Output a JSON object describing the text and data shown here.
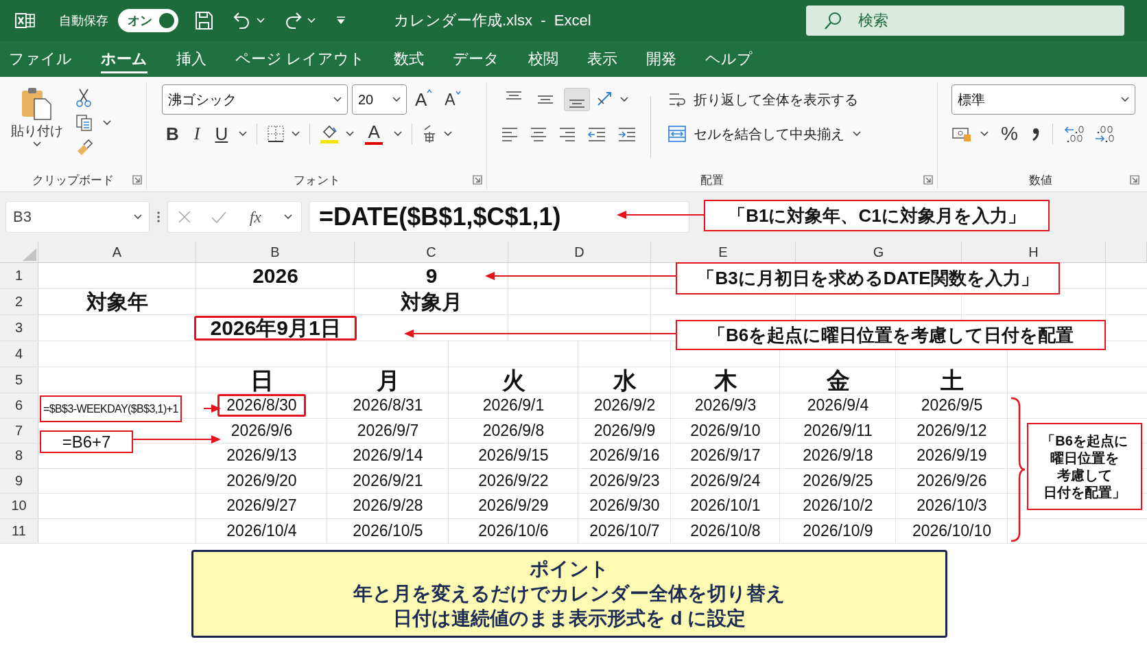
{
  "title_bar": {
    "autosave_label": "自動保存",
    "autosave": {
      "label": "オン",
      "on": true
    },
    "document_title": "カレンダー作成.xlsx  -  Excel",
    "search": {
      "placeholder": "検索"
    }
  },
  "menu_tabs": [
    {
      "label": "ファイル",
      "selected": false
    },
    {
      "label": "ホーム",
      "selected": true
    },
    {
      "label": "挿入",
      "selected": false
    },
    {
      "label": "ページ レイアウト",
      "selected": false
    },
    {
      "label": "数式",
      "selected": false
    },
    {
      "label": "データ",
      "selected": false
    },
    {
      "label": "校閲",
      "selected": false
    },
    {
      "label": "表示",
      "selected": false
    },
    {
      "label": "開発",
      "selected": false
    },
    {
      "label": "ヘルプ",
      "selected": false
    }
  ],
  "ribbon": {
    "clipboard": {
      "paste_label": "貼り付け",
      "group_label": "クリップボード"
    },
    "font": {
      "font_name": "沸ゴシック",
      "font_size": "20",
      "grow_label": "A",
      "shrink_label": "A",
      "bold_label": "B",
      "italic_label": "I",
      "underline_label": "U",
      "font_color_label": "A",
      "group_label": "フォント"
    },
    "alignment": {
      "vertical_buttons": [
        {
          "kind": "top",
          "selected": false
        },
        {
          "kind": "middle",
          "selected": false
        },
        {
          "kind": "bottom",
          "selected": true
        }
      ],
      "wrap_text_label": "折り返して全体を表示する",
      "merge_label": "セルを結合して中央揃え",
      "group_label": "配置"
    },
    "number": {
      "format": "標準",
      "percent_label": "%",
      "group_label": "数値"
    }
  },
  "formula_bar": {
    "name_box": "B3",
    "function_label": "fx",
    "formula": "=DATE($B$1,$C$1,1)"
  },
  "sheet": {
    "column_headers": [
      "A",
      "B",
      "C",
      "D",
      "E",
      "G",
      "H"
    ],
    "row_numbers": [
      "1",
      "2",
      "3",
      "4",
      "5",
      "6",
      "7",
      "8",
      "9",
      "10",
      "11"
    ],
    "rows": [
      {
        "b": "2026",
        "c": "9"
      },
      {
        "a": "対象年",
        "c": "対象月"
      },
      {
        "b": "2026年9月1日",
        "b_framed": true
      }
    ],
    "calendar": {
      "weekdays": [
        "日",
        "月",
        "火",
        "水",
        "木",
        "金",
        "土"
      ],
      "weeks": [
        {
          "days": [
            "2026/8/30",
            "2026/8/31",
            "2026/9/1",
            "2026/9/2",
            "2026/9/3",
            "2026/9/4",
            "2026/9/5"
          ],
          "first_day_framed": true
        },
        {
          "days": [
            "2026/9/6",
            "2026/9/7",
            "2026/9/8",
            "2026/9/9",
            "2026/9/10",
            "2026/9/11",
            "2026/9/12"
          ],
          "first_day_framed": false
        },
        {
          "days": [
            "2026/9/13",
            "2026/9/14",
            "2026/9/15",
            "2026/9/16",
            "2026/9/17",
            "2026/9/18",
            "2026/9/19"
          ],
          "first_day_framed": false
        },
        {
          "days": [
            "2026/9/20",
            "2026/9/21",
            "2026/9/22",
            "2026/9/23",
            "2026/9/24",
            "2026/9/25",
            "2026/9/26"
          ],
          "first_day_framed": false
        },
        {
          "days": [
            "2026/9/27",
            "2026/9/28",
            "2026/9/29",
            "2026/9/30",
            "2026/10/1",
            "2026/10/2",
            "2026/10/3"
          ],
          "first_day_framed": false
        },
        {
          "days": [
            "2026/10/4",
            "2026/10/5",
            "2026/10/6",
            "2026/10/7",
            "2026/10/8",
            "2026/10/9",
            "2026/10/10"
          ],
          "first_day_framed": false
        }
      ]
    }
  },
  "annotations": {
    "callouts": [
      "「B1に対象年、C1に対象月を入力」",
      "「B3に月初日を求めるDATE関数を入力」",
      "「B6を起点に曜日位置を考慮して日付を配置"
    ],
    "formula_notes": [
      "=$B$3-WEEKDAY($B$3,1)+1",
      "=B6+7"
    ],
    "bracket_note_lines": [
      "「B6を起点に",
      "曜日位置を",
      "考慮して",
      "日付を配置」"
    ],
    "point_box": {
      "title": "ポイント",
      "lines": [
        "年と月を変えるだけでカレンダー全体を切り替え",
        "日付は連続値のまま表示形式を d に設定"
      ]
    }
  }
}
